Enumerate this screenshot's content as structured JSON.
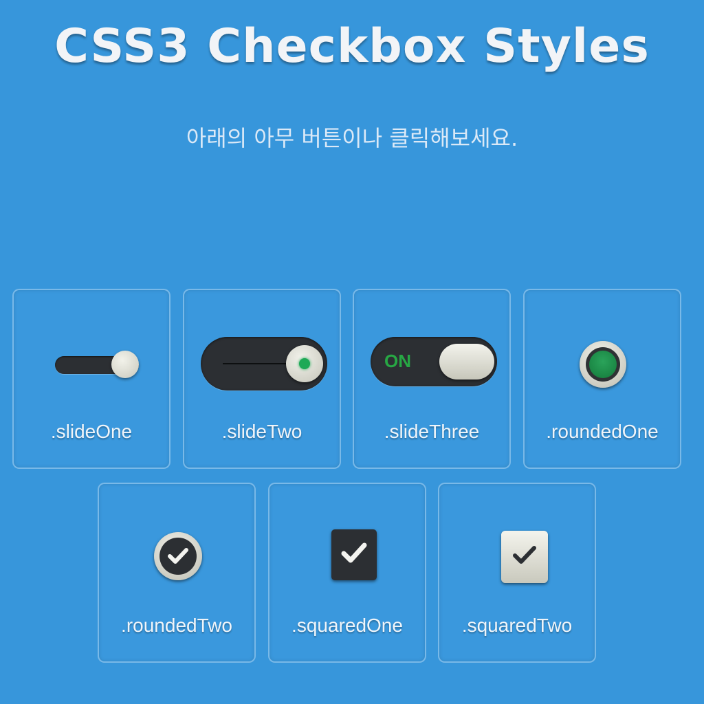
{
  "page": {
    "title": "CSS3 Checkbox Styles",
    "subtitle": "아래의 아무 버튼이나 클릭해보세요."
  },
  "colors": {
    "background": "#3796db",
    "control_dark": "#2c2f33",
    "knob_light": "#e6e6dc",
    "accent_green": "#1ea956"
  },
  "checkboxes": [
    {
      "label": ".slideOne",
      "checked": true
    },
    {
      "label": ".slideTwo",
      "checked": true
    },
    {
      "label": ".slideThree",
      "checked": true,
      "state_text": "ON"
    },
    {
      "label": ".roundedOne",
      "checked": true
    },
    {
      "label": ".roundedTwo",
      "checked": true,
      "icon": "checkmark-icon"
    },
    {
      "label": ".squaredOne",
      "checked": true,
      "icon": "checkmark-icon"
    },
    {
      "label": ".squaredTwo",
      "checked": true,
      "icon": "checkmark-icon"
    }
  ]
}
